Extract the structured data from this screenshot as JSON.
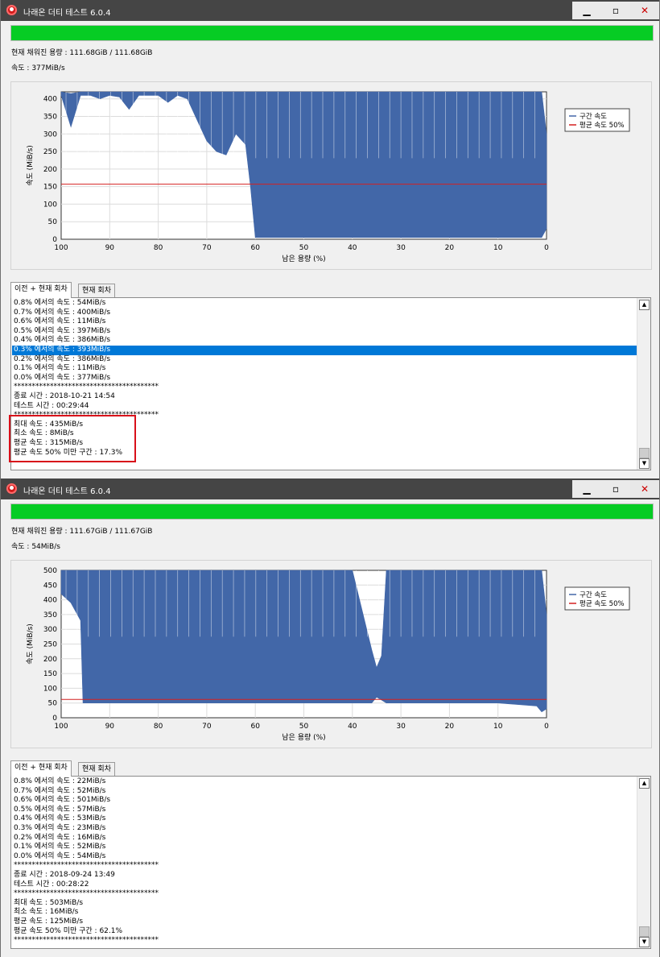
{
  "colors": {
    "series": "#4267a8",
    "avg_line": "#d42020",
    "progress": "#06cc24",
    "highlight": "#d8101a",
    "selection": "#0078d7"
  },
  "windows": [
    {
      "title": "나래온 더티 테스트 6.0.4",
      "progress_percent": 100,
      "capacity_text": "현재 채워진 용량 : 111.68GiB / 111.68GiB",
      "speed_text": "속도 : 377MiB/s",
      "tabs": [
        "이전 + 현재 회차",
        "현재 회차"
      ],
      "log_lines": [
        "0.8% 에서의 속도 : 54MiB/s",
        "0.7% 에서의 속도 : 400MiB/s",
        "0.6% 에서의 속도 : 11MiB/s",
        "0.5% 에서의 속도 : 397MiB/s",
        "0.4% 에서의 속도 : 386MiB/s",
        "0.3% 에서의 속도 : 393MiB/s",
        "0.2% 에서의 속도 : 386MiB/s",
        "0.1% 에서의 속도 : 11MiB/s",
        "0.0% 에서의 속도 : 377MiB/s",
        "****************************************",
        "종료 시간 : 2018-10-21 14:54",
        "테스트 시간 : 00:29:44",
        "****************************************",
        "최대 속도 : 435MiB/s",
        "최소 속도 : 8MiB/s",
        "평균 속도 : 315MiB/s",
        "평균 속도 50% 미만 구간 : 17.3%"
      ],
      "selected_line": 5,
      "highlight_summary": true
    },
    {
      "title": "나래온 더티 테스트 6.0.4",
      "progress_percent": 100,
      "capacity_text": "현재 채워진 용량 : 111.67GiB / 111.67GiB",
      "speed_text": "속도 : 54MiB/s",
      "tabs": [
        "이전 + 현재 회차",
        "현재 회차"
      ],
      "log_lines": [
        "0.8% 에서의 속도 : 22MiB/s",
        "0.7% 에서의 속도 : 52MiB/s",
        "0.6% 에서의 속도 : 501MiB/s",
        "0.5% 에서의 속도 : 57MiB/s",
        "0.4% 에서의 속도 : 53MiB/s",
        "0.3% 에서의 속도 : 23MiB/s",
        "0.2% 에서의 속도 : 16MiB/s",
        "0.1% 에서의 속도 : 52MiB/s",
        "0.0% 에서의 속도 : 54MiB/s",
        "****************************************",
        "종료 시간 : 2018-09-24 13:49",
        "테스트 시간 : 00:28:22",
        "****************************************",
        "최대 속도 : 503MiB/s",
        "최소 속도 : 16MiB/s",
        "평균 속도 : 125MiB/s",
        "평균 속도 50% 미만 구간 : 62.1%",
        "****************************************"
      ],
      "selected_line": -1,
      "highlight_summary": false
    }
  ],
  "chart_data": [
    {
      "type": "area",
      "xlabel": "남은 용량 (%)",
      "ylabel": "속도 (MiB/s)",
      "xlim": [
        100,
        0
      ],
      "ylim": [
        0,
        420
      ],
      "yticks": [
        0,
        50,
        100,
        150,
        200,
        250,
        300,
        350,
        400
      ],
      "xticks": [
        100,
        90,
        80,
        70,
        60,
        50,
        40,
        30,
        20,
        10,
        0
      ],
      "grid": true,
      "legend_position": "top-right",
      "legend": [
        "구간 속도",
        "평균 속도 50%"
      ],
      "avg50": 157,
      "series": [
        {
          "x": [
            100,
            98,
            96,
            94,
            92,
            90,
            88,
            86,
            84,
            82,
            80,
            78,
            76,
            74,
            72,
            70,
            68,
            66,
            64,
            62,
            61,
            60,
            50,
            40,
            30,
            20,
            10,
            1,
            0
          ],
          "y": [
            410,
            320,
            410,
            410,
            400,
            410,
            405,
            370,
            410,
            410,
            410,
            390,
            410,
            400,
            340,
            280,
            250,
            240,
            300,
            270,
            150,
            5,
            5,
            5,
            5,
            5,
            5,
            5,
            30
          ],
          "upper": [
            420,
            415,
            420,
            420,
            420,
            420,
            420,
            420,
            420,
            420,
            420,
            420,
            420,
            420,
            420,
            420,
            420,
            420,
            420,
            420,
            420,
            420,
            420,
            420,
            420,
            420,
            420,
            420,
            300
          ]
        }
      ]
    },
    {
      "type": "area",
      "xlabel": "남은 용량 (%)",
      "ylabel": "속도 (MiB/s)",
      "xlim": [
        100,
        0
      ],
      "ylim": [
        0,
        500
      ],
      "yticks": [
        0,
        50,
        100,
        150,
        200,
        250,
        300,
        350,
        400,
        450,
        500
      ],
      "xticks": [
        100,
        90,
        80,
        70,
        60,
        50,
        40,
        30,
        20,
        10,
        0
      ],
      "grid": true,
      "legend_position": "top-right",
      "legend": [
        "구간 속도",
        "평균 속도 50%"
      ],
      "avg50": 62,
      "series": [
        {
          "x": [
            100,
            98,
            96,
            95.5,
            95,
            90,
            80,
            70,
            60,
            50,
            40,
            36,
            35,
            34,
            33,
            30,
            20,
            10,
            2,
            1,
            0
          ],
          "y": [
            420,
            390,
            330,
            50,
            50,
            50,
            50,
            50,
            50,
            50,
            50,
            50,
            70,
            60,
            50,
            50,
            50,
            50,
            40,
            20,
            30
          ],
          "upper": [
            500,
            500,
            500,
            500,
            500,
            500,
            500,
            500,
            500,
            500,
            500,
            230,
            170,
            210,
            500,
            500,
            500,
            500,
            500,
            500,
            350
          ]
        }
      ]
    }
  ]
}
